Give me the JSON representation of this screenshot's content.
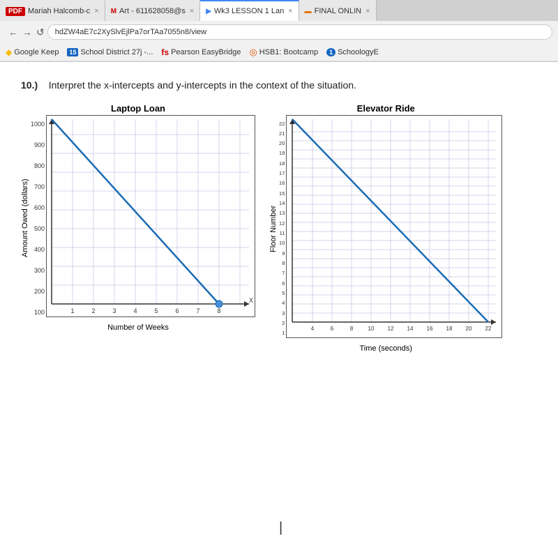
{
  "browser": {
    "tabs": [
      {
        "id": "tab1",
        "label": "Mariah Halcomb-c",
        "icon_type": "pdf",
        "active": false
      },
      {
        "id": "tab2",
        "label": "Art - 611628058@s",
        "icon_type": "gmail",
        "active": false
      },
      {
        "id": "tab3",
        "label": "Wk3 LESSON 1 Lan",
        "icon_type": "docs",
        "active": true
      },
      {
        "id": "tab4",
        "label": "FINAL ONLIN",
        "icon_type": "slides",
        "active": false
      }
    ],
    "address": "hdZW4aE7c2XySlvEjlPa7orTAa7055n8/view",
    "bookmarks": [
      {
        "label": "Google Keep",
        "icon": "G"
      },
      {
        "label": "School District 27j -...",
        "icon": "15"
      },
      {
        "label": "Pearson EasyBridge",
        "icon": "fs"
      },
      {
        "label": "HSB1: Bootcamp",
        "icon": "○"
      },
      {
        "label": "SchoologyE",
        "icon": "1"
      }
    ]
  },
  "page": {
    "question_number": "10.)",
    "question_text": "Interpret the x-intercepts and y-intercepts in the context of the situation.",
    "graph1": {
      "title": "Laptop Loan",
      "y_label": "Amount Owed (dollars)",
      "x_label": "Number of Weeks",
      "y_max": 1000,
      "y_ticks": [
        "100",
        "200",
        "300",
        "400",
        "500",
        "600",
        "700",
        "800",
        "900",
        "1000"
      ],
      "x_ticks": [
        "1",
        "2",
        "3",
        "4",
        "5",
        "6",
        "7",
        "8"
      ],
      "line_start": {
        "x": 0,
        "y": 1000
      },
      "line_end": {
        "x": 8,
        "y": 0
      }
    },
    "graph2": {
      "title": "Elevator Ride",
      "y_label": "Floor Number",
      "x_label": "Time (seconds)",
      "y_max": 22,
      "y_ticks": [
        "1",
        "2",
        "3",
        "4",
        "5",
        "6",
        "7",
        "8",
        "9",
        "10",
        "11",
        "12",
        "13",
        "14",
        "15",
        "16",
        "17",
        "18",
        "19",
        "20",
        "21",
        "22"
      ],
      "x_ticks": [
        "4",
        "6",
        "8",
        "10",
        "12",
        "14",
        "16",
        "18",
        "20",
        "22"
      ],
      "line_start": {
        "x": 0,
        "y": 22
      },
      "line_end": {
        "x": 22,
        "y": 0
      }
    }
  }
}
